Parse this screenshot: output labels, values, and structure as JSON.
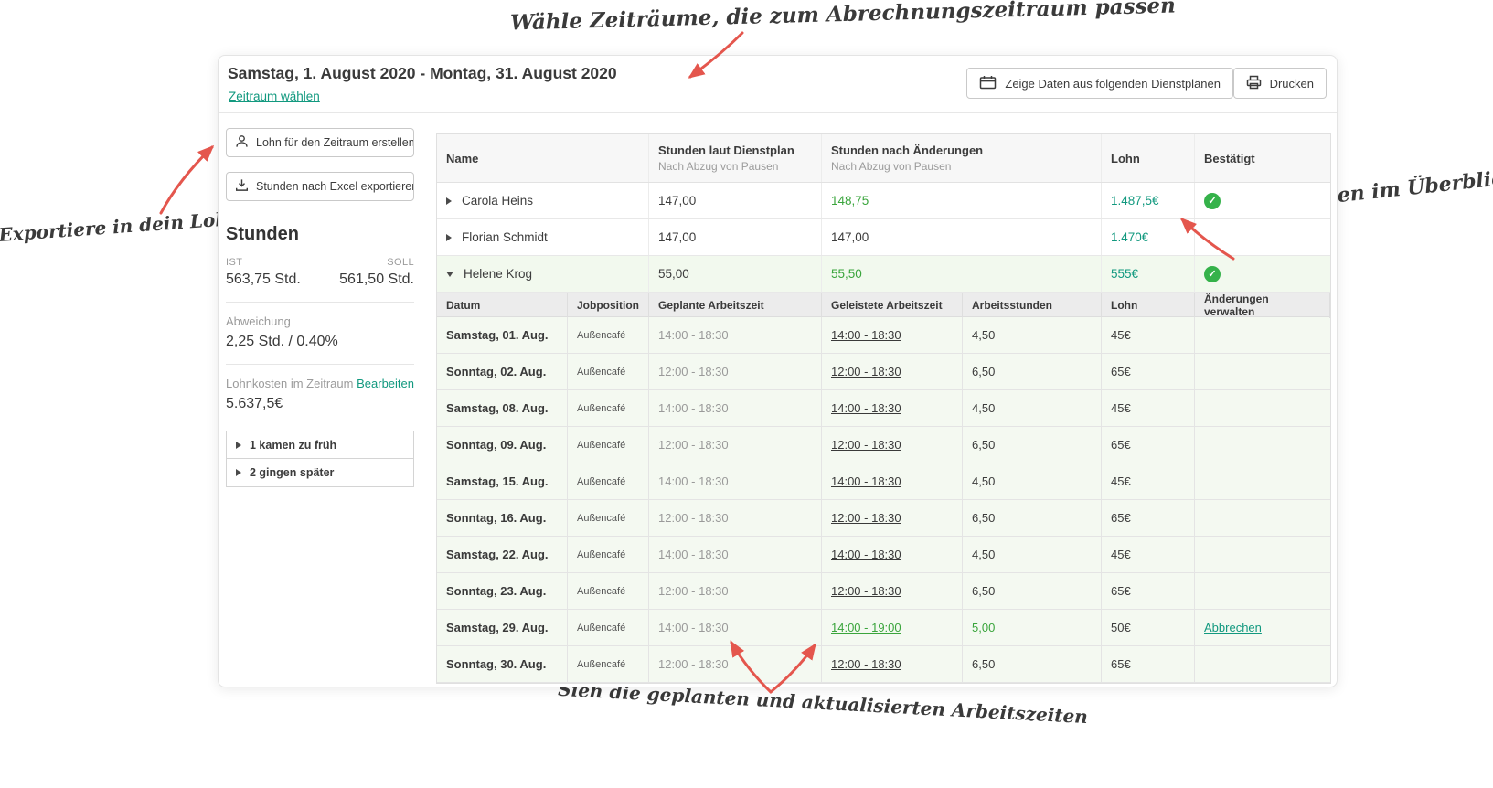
{
  "annotations": {
    "top": "Wähle Zeiträume, die zum Abrechnungszeitraum passen",
    "left": "Exportiere in dein Lohnabrechnungssystem",
    "right": "Lohnkosten im Überblick",
    "bottom": "Sieh die geplanten und aktualisierten Arbeitszeiten"
  },
  "header": {
    "title": "Samstag, 1. August 2020 - Montag, 31. August 2020",
    "period_link": "Zeitraum wählen",
    "schedule_button": "Zeige Daten aus folgenden Dienstplänen",
    "print_button": "Drucken"
  },
  "sidebar": {
    "create_payroll_button": "Lohn für den Zeitraum erstellen",
    "export_excel_button": "Stunden nach Excel exportieren",
    "hours_title": "Stunden",
    "ist_label": "IST",
    "soll_label": "SOLL",
    "ist_value": "563,75 Std.",
    "soll_value": "561,50 Std.",
    "deviation_label": "Abweichung",
    "deviation_value": "2,25 Std. / 0.40%",
    "labor_cost_label": "Lohnkosten im Zeitraum",
    "edit_link": "Bearbeiten",
    "labor_cost_value": "5.637,5€",
    "came_early": "1 kamen zu früh",
    "left_late": "2 gingen später"
  },
  "colors": {
    "teal": "#12997f",
    "green": "#3aa53c",
    "annotation_red": "#e4564d"
  },
  "table": {
    "headers": {
      "name": "Name",
      "planned": "Stunden laut Dienstplan",
      "planned_sub": "Nach Abzug von Pausen",
      "changed": "Stunden nach Änderungen",
      "changed_sub": "Nach Abzug von Pausen",
      "wage": "Lohn",
      "confirmed": "Bestätigt"
    },
    "employees": [
      {
        "name": "Carola Heins",
        "planned": "147,00",
        "changed": "148,75",
        "wage": "1.487,5€"
      },
      {
        "name": "Florian Schmidt",
        "planned": "147,00",
        "changed": "147,00",
        "wage": "1.470€"
      },
      {
        "name": "Helene Krog",
        "planned": "55,00",
        "changed": "55,50",
        "wage": "555€"
      }
    ],
    "detail_headers": {
      "date": "Datum",
      "job": "Jobposition",
      "planned": "Geplante Arbeitszeit",
      "worked": "Geleistete Arbeitszeit",
      "hours": "Arbeitsstunden",
      "wage": "Lohn",
      "actions": "Änderungen verwalten"
    },
    "detail_rows": [
      {
        "date": "Samstag, 01. Aug.",
        "job": "Außencafé",
        "planned": "14:00 - 18:30",
        "worked": "14:00 - 18:30",
        "hours": "4,50",
        "wage": "45€",
        "action": ""
      },
      {
        "date": "Sonntag, 02. Aug.",
        "job": "Außencafé",
        "planned": "12:00 - 18:30",
        "worked": "12:00 - 18:30",
        "hours": "6,50",
        "wage": "65€",
        "action": ""
      },
      {
        "date": "Samstag, 08. Aug.",
        "job": "Außencafé",
        "planned": "14:00 - 18:30",
        "worked": "14:00 - 18:30",
        "hours": "4,50",
        "wage": "45€",
        "action": ""
      },
      {
        "date": "Sonntag, 09. Aug.",
        "job": "Außencafé",
        "planned": "12:00 - 18:30",
        "worked": "12:00 - 18:30",
        "hours": "6,50",
        "wage": "65€",
        "action": ""
      },
      {
        "date": "Samstag, 15. Aug.",
        "job": "Außencafé",
        "planned": "14:00 - 18:30",
        "worked": "14:00 - 18:30",
        "hours": "4,50",
        "wage": "45€",
        "action": ""
      },
      {
        "date": "Sonntag, 16. Aug.",
        "job": "Außencafé",
        "planned": "12:00 - 18:30",
        "worked": "12:00 - 18:30",
        "hours": "6,50",
        "wage": "65€",
        "action": ""
      },
      {
        "date": "Samstag, 22. Aug.",
        "job": "Außencafé",
        "planned": "14:00 - 18:30",
        "worked": "14:00 - 18:30",
        "hours": "4,50",
        "wage": "45€",
        "action": ""
      },
      {
        "date": "Sonntag, 23. Aug.",
        "job": "Außencafé",
        "planned": "12:00 - 18:30",
        "worked": "12:00 - 18:30",
        "hours": "6,50",
        "wage": "65€",
        "action": ""
      },
      {
        "date": "Samstag, 29. Aug.",
        "job": "Außencafé",
        "planned": "14:00 - 18:30",
        "worked": "14:00 - 19:00",
        "hours": "5,00",
        "wage": "50€",
        "action": "Abbrechen"
      },
      {
        "date": "Sonntag, 30. Aug.",
        "job": "Außencafé",
        "planned": "12:00 - 18:30",
        "worked": "12:00 - 18:30",
        "hours": "6,50",
        "wage": "65€",
        "action": ""
      }
    ]
  }
}
